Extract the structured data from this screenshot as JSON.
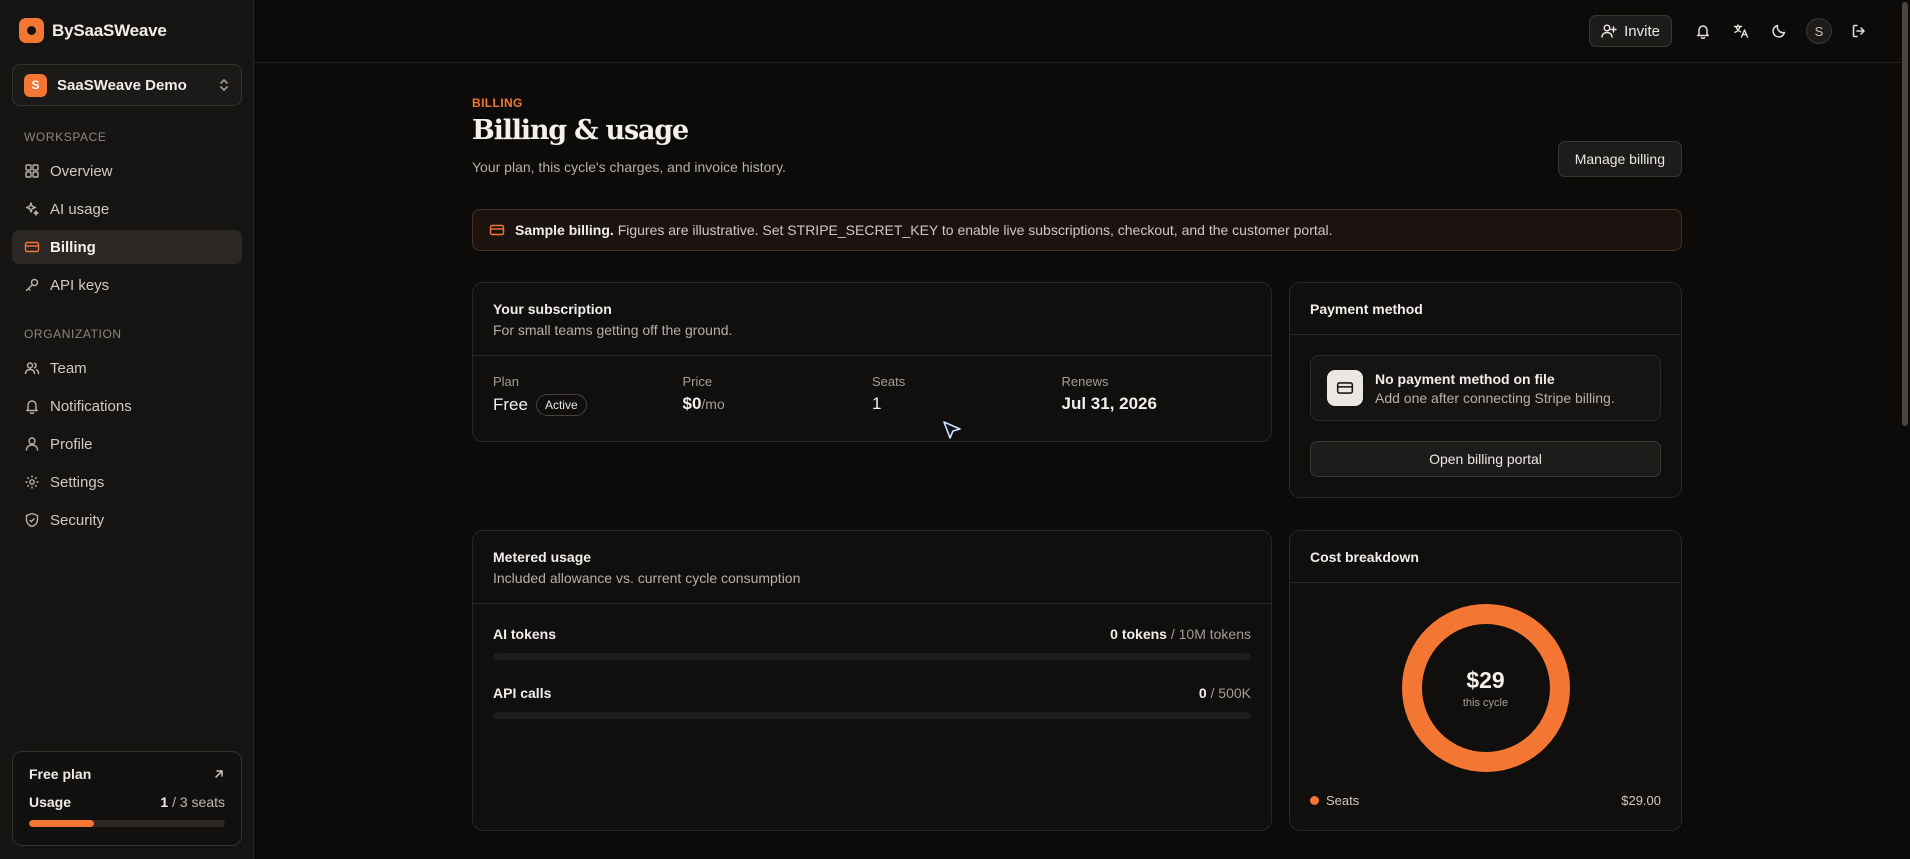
{
  "brand": {
    "name": "BySaaSWeave",
    "accent": "#f47633"
  },
  "workspace": {
    "initial": "S",
    "name": "SaaSWeave Demo"
  },
  "sidebar": {
    "sections": [
      {
        "label": "WORKSPACE",
        "items": [
          {
            "label": "Overview",
            "icon": "grid-icon"
          },
          {
            "label": "AI usage",
            "icon": "sparkles-icon"
          },
          {
            "label": "Billing",
            "icon": "credit-card-icon",
            "active": true
          },
          {
            "label": "API keys",
            "icon": "key-icon"
          }
        ]
      },
      {
        "label": "ORGANIZATION",
        "items": [
          {
            "label": "Team",
            "icon": "users-icon"
          },
          {
            "label": "Notifications",
            "icon": "bell-icon"
          },
          {
            "label": "Profile",
            "icon": "user-icon"
          },
          {
            "label": "Settings",
            "icon": "gear-icon"
          },
          {
            "label": "Security",
            "icon": "shield-icon"
          }
        ]
      }
    ],
    "plan_card": {
      "title": "Free plan",
      "usage_label": "Usage",
      "usage_used": "1",
      "usage_total": "/ 3 seats",
      "usage_fraction": 0.33
    }
  },
  "topbar": {
    "invite_label": "Invite",
    "user_initial": "S"
  },
  "page": {
    "eyebrow": "BILLING",
    "title": "Billing & usage",
    "subtitle": "Your plan, this cycle's charges, and invoice history.",
    "manage_label": "Manage billing"
  },
  "notice": {
    "strong": "Sample billing.",
    "text": "Figures are illustrative. Set STRIPE_SECRET_KEY to enable live subscriptions, checkout, and the customer portal."
  },
  "subscription": {
    "title": "Your subscription",
    "desc": "For small teams getting off the ground.",
    "plan_label": "Plan",
    "plan_value": "Free",
    "plan_badge": "Active",
    "price_label": "Price",
    "price_value": "$0",
    "price_unit": "/mo",
    "seats_label": "Seats",
    "seats_value": "1",
    "renews_label": "Renews",
    "renews_value": "Jul 31, 2026"
  },
  "payment": {
    "title": "Payment method",
    "empty_title": "No payment method on file",
    "empty_desc": "Add one after connecting Stripe billing.",
    "portal_label": "Open billing portal"
  },
  "metered": {
    "title": "Metered usage",
    "desc": "Included allowance vs. current cycle consumption",
    "rows": [
      {
        "label": "AI tokens",
        "used": "0 tokens",
        "limit": "/ 10M tokens",
        "fraction": 0
      },
      {
        "label": "API calls",
        "used": "0",
        "limit": "/ 500K",
        "fraction": 0
      }
    ]
  },
  "cost": {
    "title": "Cost breakdown",
    "total": "$29",
    "caption": "this cycle",
    "legend": [
      {
        "label": "Seats",
        "value": "$29.00",
        "share": 1.0,
        "color": "#f47633"
      }
    ]
  }
}
